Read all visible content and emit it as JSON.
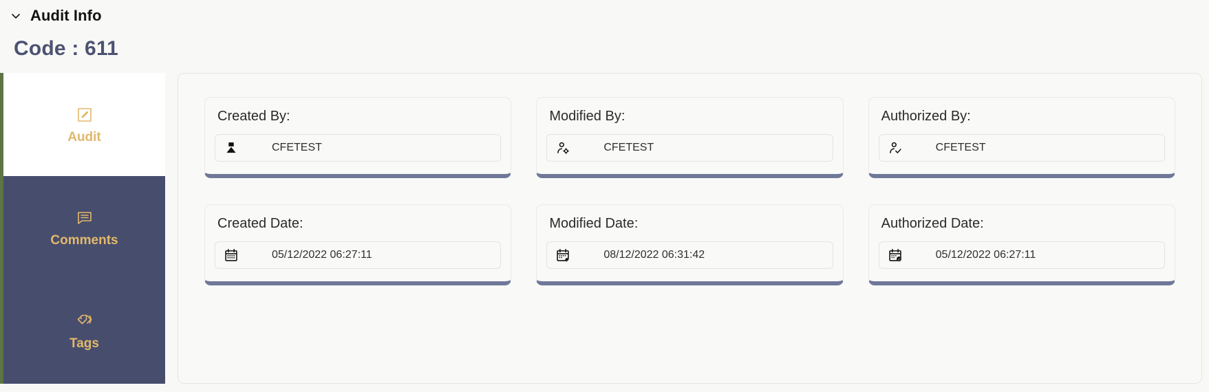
{
  "header": {
    "collapse_icon": "chevron-down-icon",
    "title": "Audit Info",
    "code_label": "Code : 611"
  },
  "sidebar": {
    "items": [
      {
        "id": "audit",
        "label": "Audit",
        "icon": "edit-square-icon",
        "active": true
      },
      {
        "id": "comments",
        "label": "Comments",
        "icon": "comment-icon",
        "active": false
      },
      {
        "id": "tags",
        "label": "Tags",
        "icon": "tag-icon",
        "active": false
      }
    ],
    "colors": {
      "background": "#474d6d",
      "active_background": "#ffffff",
      "text": "#e3b96b",
      "left_border": "#5d7544"
    }
  },
  "main": {
    "accent_color": "#6f7899",
    "cards": [
      {
        "label": "Created By:",
        "value": "CFETEST",
        "icon": "user-filled-icon"
      },
      {
        "label": "Modified By:",
        "value": "CFETEST",
        "icon": "user-settings-icon"
      },
      {
        "label": "Authorized By:",
        "value": "CFETEST",
        "icon": "user-check-icon"
      },
      {
        "label": "Created Date:",
        "value": "05/12/2022 06:27:11",
        "icon": "calendar-icon"
      },
      {
        "label": "Modified Date:",
        "value": "08/12/2022 06:31:42",
        "icon": "calendar-plus-icon"
      },
      {
        "label": "Authorized Date:",
        "value": "05/12/2022 06:27:11",
        "icon": "calendar-clock-icon"
      }
    ]
  }
}
